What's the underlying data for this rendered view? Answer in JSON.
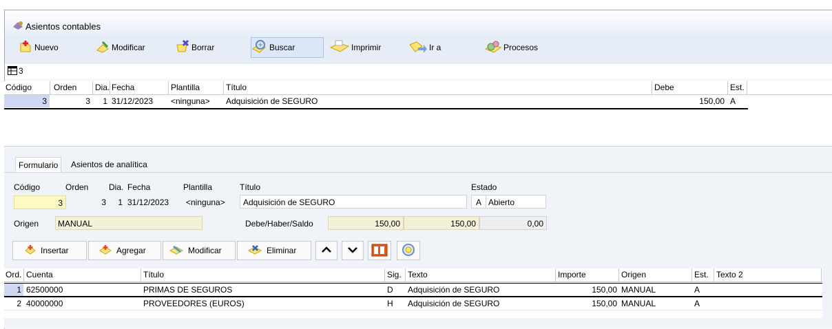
{
  "window": {
    "title": "Asientos contables"
  },
  "toolbar": {
    "nuevo": "Nuevo",
    "modificar": "Modificar",
    "borrar": "Borrar",
    "buscar": "Buscar",
    "imprimir": "Imprimir",
    "ir_a": "Ir a",
    "procesos": "Procesos"
  },
  "record_count": "3",
  "grid1": {
    "headers": {
      "codigo": "Código",
      "orden": "Orden",
      "dia": "Dia.",
      "fecha": "Fecha",
      "plantilla": "Plantilla",
      "titulo": "Título",
      "debe": "Debe",
      "est": "Est."
    },
    "row": {
      "codigo": "3",
      "orden": "3",
      "dia": "1",
      "fecha": "31/12/2023",
      "plantilla": "<ninguna>",
      "titulo": "Adquisición de SEGURO",
      "debe": "150,00",
      "est": "A"
    }
  },
  "tabs": {
    "formulario": "Formulario",
    "analitica": "Asientos de analítica"
  },
  "form": {
    "labels": {
      "codigo": "Código",
      "orden": "Orden",
      "dia": "Dia.",
      "fecha": "Fecha",
      "plantilla": "Plantilla",
      "titulo": "Título",
      "estado": "Estado",
      "origen": "Origen",
      "dhs": "Debe/Haber/Saldo"
    },
    "values": {
      "codigo": "3",
      "orden": "3",
      "dia": "1",
      "fecha": "31/12/2023",
      "plantilla": "<ninguna>",
      "titulo": "Adquisición de SEGURO",
      "estado_code": "A",
      "estado_text": "Abierto",
      "origen": "MANUAL",
      "debe": "150,00",
      "haber": "150,00",
      "saldo": "0,00"
    }
  },
  "actions": {
    "insertar": "Insertar",
    "agregar": "Agregar",
    "modificar": "Modificar",
    "eliminar": "Eliminar"
  },
  "grid2": {
    "headers": {
      "ord": "Ord.",
      "cuenta": "Cuenta",
      "titulo": "Título",
      "sig": "Sig.",
      "texto": "Texto",
      "importe": "Importe",
      "origen": "Origen",
      "est": "Est.",
      "texto2": "Texto 2"
    },
    "rows": [
      {
        "ord": "1",
        "cuenta": "62500000",
        "titulo": "PRIMAS DE SEGUROS",
        "sig": "D",
        "texto": "Adquisición de SEGURO",
        "importe": "150,00",
        "origen": "MANUAL",
        "est": "A"
      },
      {
        "ord": "2",
        "cuenta": "40000000",
        "titulo": "PROVEEDORES (EUROS)",
        "sig": "H",
        "texto": "Adquisición de SEGURO",
        "importe": "150,00",
        "origen": "MANUAL",
        "est": "A"
      }
    ]
  },
  "colors": {
    "selected_row": "#cfd8f3",
    "key_field": "#fff9c4",
    "readonly_field": "#f5f1d8"
  }
}
